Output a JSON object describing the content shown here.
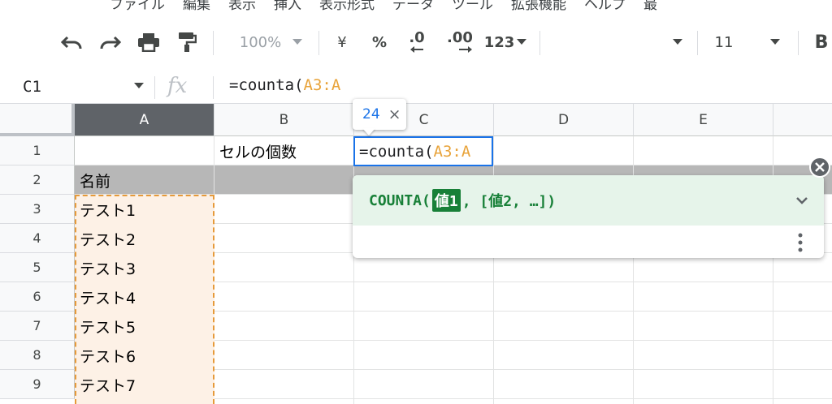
{
  "menu": [
    "ファイル",
    "編集",
    "表示",
    "挿入",
    "表示形式",
    "データ",
    "ツール",
    "拡張機能",
    "ヘルプ",
    "最"
  ],
  "toolbar": {
    "zoom": "100%",
    "currency": "¥",
    "percent": "%",
    "dec_decrease": ".0",
    "dec_increase": ".00",
    "number_format": "123",
    "font_size": "11",
    "bold": "B"
  },
  "formula_bar": {
    "cell_ref": "C1",
    "fx_label": "fx",
    "prefix": "=counta(",
    "range": "A3:A"
  },
  "columns": [
    "A",
    "B",
    "C",
    "D",
    "E"
  ],
  "rows": [
    "1",
    "2",
    "3",
    "4",
    "5",
    "6",
    "7",
    "8",
    "9"
  ],
  "cells": {
    "B1": "セルの個数",
    "A2": "名前",
    "A3": "テスト1",
    "A4": "テスト2",
    "A5": "テスト3",
    "A6": "テスト4",
    "A7": "テスト5",
    "A8": "テスト6",
    "A9": "テスト7"
  },
  "active_cell": {
    "prefix": "=counta(",
    "range": "A3:A"
  },
  "value_tooltip": {
    "value": "24",
    "close": "×"
  },
  "function_help": {
    "name": "COUNTA(",
    "arg_highlight": "値1",
    "rest": ", [値2, …])"
  },
  "colors": {
    "accent": "#1a73e8",
    "range_border": "#e69a3a",
    "range_fill": "#fdf1e6",
    "help_green": "#188038",
    "help_bg": "#e6f4ea"
  }
}
